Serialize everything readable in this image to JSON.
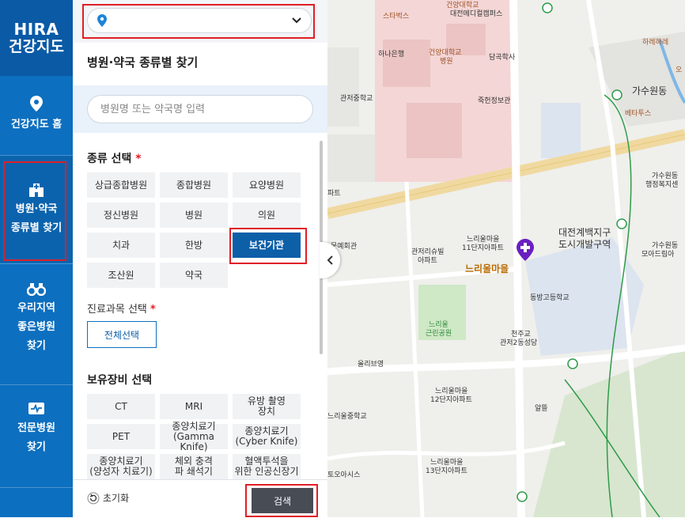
{
  "sidebar": {
    "logo_line1": "HIRA",
    "logo_line2": "건강지도",
    "items": [
      {
        "label": "건강지도 홈"
      },
      {
        "label_line1": "병원·약국",
        "label_line2": "종류별 찾기"
      },
      {
        "label_line1": "우리지역",
        "label_line2": "좋은병원",
        "label_line3": "찾기"
      },
      {
        "label_line1": "전문병원",
        "label_line2": "찾기"
      }
    ]
  },
  "panel": {
    "title": "병원·약국 종류별 찾기",
    "search_placeholder": "병원명 또는 약국명 입력",
    "type_section_title": "종류 선택",
    "required_mark": "*",
    "types": [
      "상급종합병원",
      "종합병원",
      "요양병원",
      "정신병원",
      "병원",
      "의원",
      "치과",
      "한방",
      "보건기관",
      "조산원",
      "약국"
    ],
    "selected_type": "보건기관",
    "dept_section_title": "진료과목 선택",
    "select_all_label": "전체선택",
    "equip_section_title": "보유장비 선택",
    "equipment": [
      {
        "line1": "CT",
        "line2": ""
      },
      {
        "line1": "MRI",
        "line2": ""
      },
      {
        "line1": "유방 촬영",
        "line2": "장치"
      },
      {
        "line1": "PET",
        "line2": ""
      },
      {
        "line1": "종양치료기",
        "line2": "(Gamma Knife)"
      },
      {
        "line1": "종양치료기",
        "line2": "(Cyber Knife)"
      },
      {
        "line1": "종양치료기",
        "line2": "(양성자 치료기)"
      },
      {
        "line1": "체외 충격",
        "line2": "파 쇄석기"
      },
      {
        "line1": "혈액투석을",
        "line2": "위한 인공신장기"
      }
    ],
    "reset_label": "초기화",
    "search_button": "검색"
  },
  "map": {
    "labels": [
      {
        "text": "건양대학교"
      },
      {
        "text": "대전메디컬캠퍼스"
      },
      {
        "text": "스타벅스"
      },
      {
        "text": "하나은행"
      },
      {
        "text": "건양대학교"
      },
      {
        "text": "병원"
      },
      {
        "text": "담곡학사"
      },
      {
        "text": "관저중학교"
      },
      {
        "text": "죽헌정보관"
      },
      {
        "text": "가수원동"
      },
      {
        "text": "베타투스"
      },
      {
        "text": "하레하레"
      },
      {
        "text": "가수원동"
      },
      {
        "text": "행정복지센"
      },
      {
        "text": "대전계백지구"
      },
      {
        "text": "도시개발구역"
      },
      {
        "text": "가수원동"
      },
      {
        "text": "모아드림아"
      },
      {
        "text": "느리울마을"
      },
      {
        "text": "11단지아파트"
      },
      {
        "text": "관저리슈빌"
      },
      {
        "text": "아파트"
      },
      {
        "text": "느리울마을"
      },
      {
        "text": "동방고등학교"
      },
      {
        "text": "문예회관"
      },
      {
        "text": "파트"
      },
      {
        "text": "느리울"
      },
      {
        "text": "근린공원"
      },
      {
        "text": "천주교"
      },
      {
        "text": "관저2동성당"
      },
      {
        "text": "올리브영"
      },
      {
        "text": "느리울마을"
      },
      {
        "text": "12단지아파트"
      },
      {
        "text": "느리울중학교"
      },
      {
        "text": "알뜰"
      },
      {
        "text": "느리울마을"
      },
      {
        "text": "13단지아파트"
      },
      {
        "text": "토오아시스"
      },
      {
        "text": "오"
      }
    ]
  },
  "colors": {
    "sidebar_blue": "#0d6fbf",
    "selected_chip": "#0d5fa8",
    "highlight_red": "#e01e26",
    "search_button": "#474c55"
  },
  "icons": [
    "location-pin-icon",
    "chevron-down-icon",
    "hospital-icon",
    "binoculars-icon",
    "specialist-icon",
    "refresh-icon",
    "chevron-left-icon",
    "hospital-marker-icon"
  ]
}
